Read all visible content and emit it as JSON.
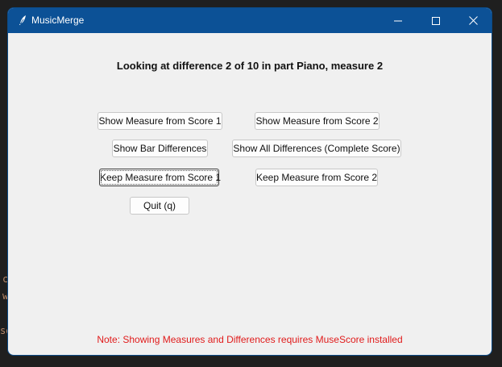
{
  "window": {
    "title": "MusicMerge",
    "app_icon": "quill-icon",
    "controls": [
      "minimize-icon",
      "maximize-icon",
      "close-icon"
    ]
  },
  "heading": "Looking at difference 2 of 10 in part Piano, measure 2",
  "buttons": {
    "show_measure_score1": "Show Measure from Score 1",
    "show_measure_score2": "Show Measure from Score 2",
    "show_bar_differences": "Show Bar Differences",
    "show_all_differences": "Show All Differences (Complete Score)",
    "keep_measure_score1": "Keep Measure from Score 1",
    "keep_measure_score2": "Keep Measure from Score 2",
    "quit": "Quit (q)"
  },
  "note": "Note: Showing Measures and Differences requires MuseScore installed",
  "colors": {
    "titlebar": "#0c5196",
    "note_text": "#e01b1b",
    "window_bg": "#f0f0f0"
  }
}
